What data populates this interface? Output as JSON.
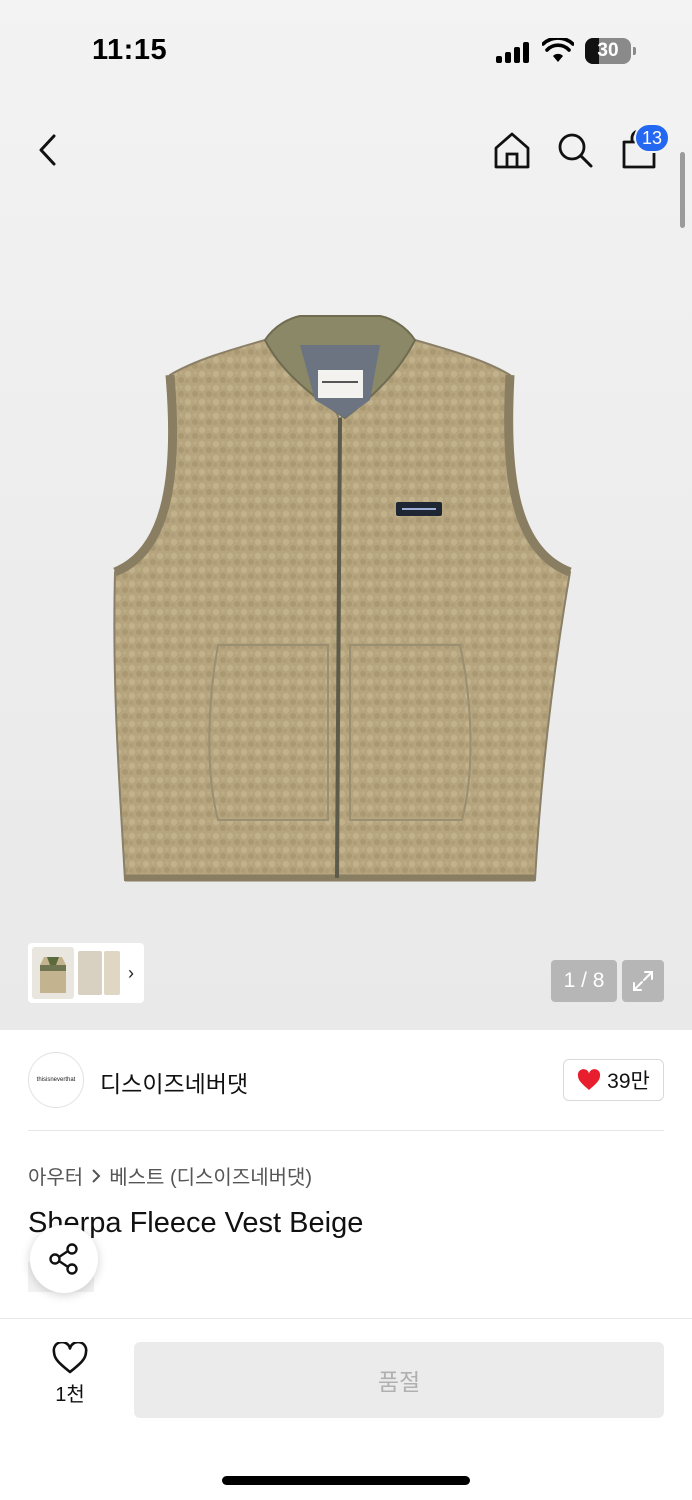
{
  "status_bar": {
    "time": "11:15",
    "battery": "30",
    "battery_level_percent": 30
  },
  "header": {
    "back_icon": "chevron-left-icon",
    "home_icon": "home-icon",
    "search_icon": "search-icon",
    "cart_icon": "shopping-bag-icon",
    "cart_badge": "13",
    "badge_color": "#2468f2"
  },
  "gallery": {
    "counter": "1 / 8",
    "expand_icon": "expand-icon",
    "thumb_more_icon": "chevron-right-icon"
  },
  "brand": {
    "logo_text": "thisisneverthat",
    "name": "디스이즈네버댓",
    "likes": "39만",
    "heart_color": "#e81d2d"
  },
  "breadcrumb": {
    "category": "아우터",
    "separator_icon": "chevron-right-icon",
    "subcategory": "베스트 (디스이즈네버댓)"
  },
  "product": {
    "title": "Sherpa Fleece Vest Beige",
    "share_icon": "share-icon"
  },
  "bottom_bar": {
    "wish_icon": "heart-outline-icon",
    "wish_count": "1천",
    "soldout_label": "품절"
  }
}
